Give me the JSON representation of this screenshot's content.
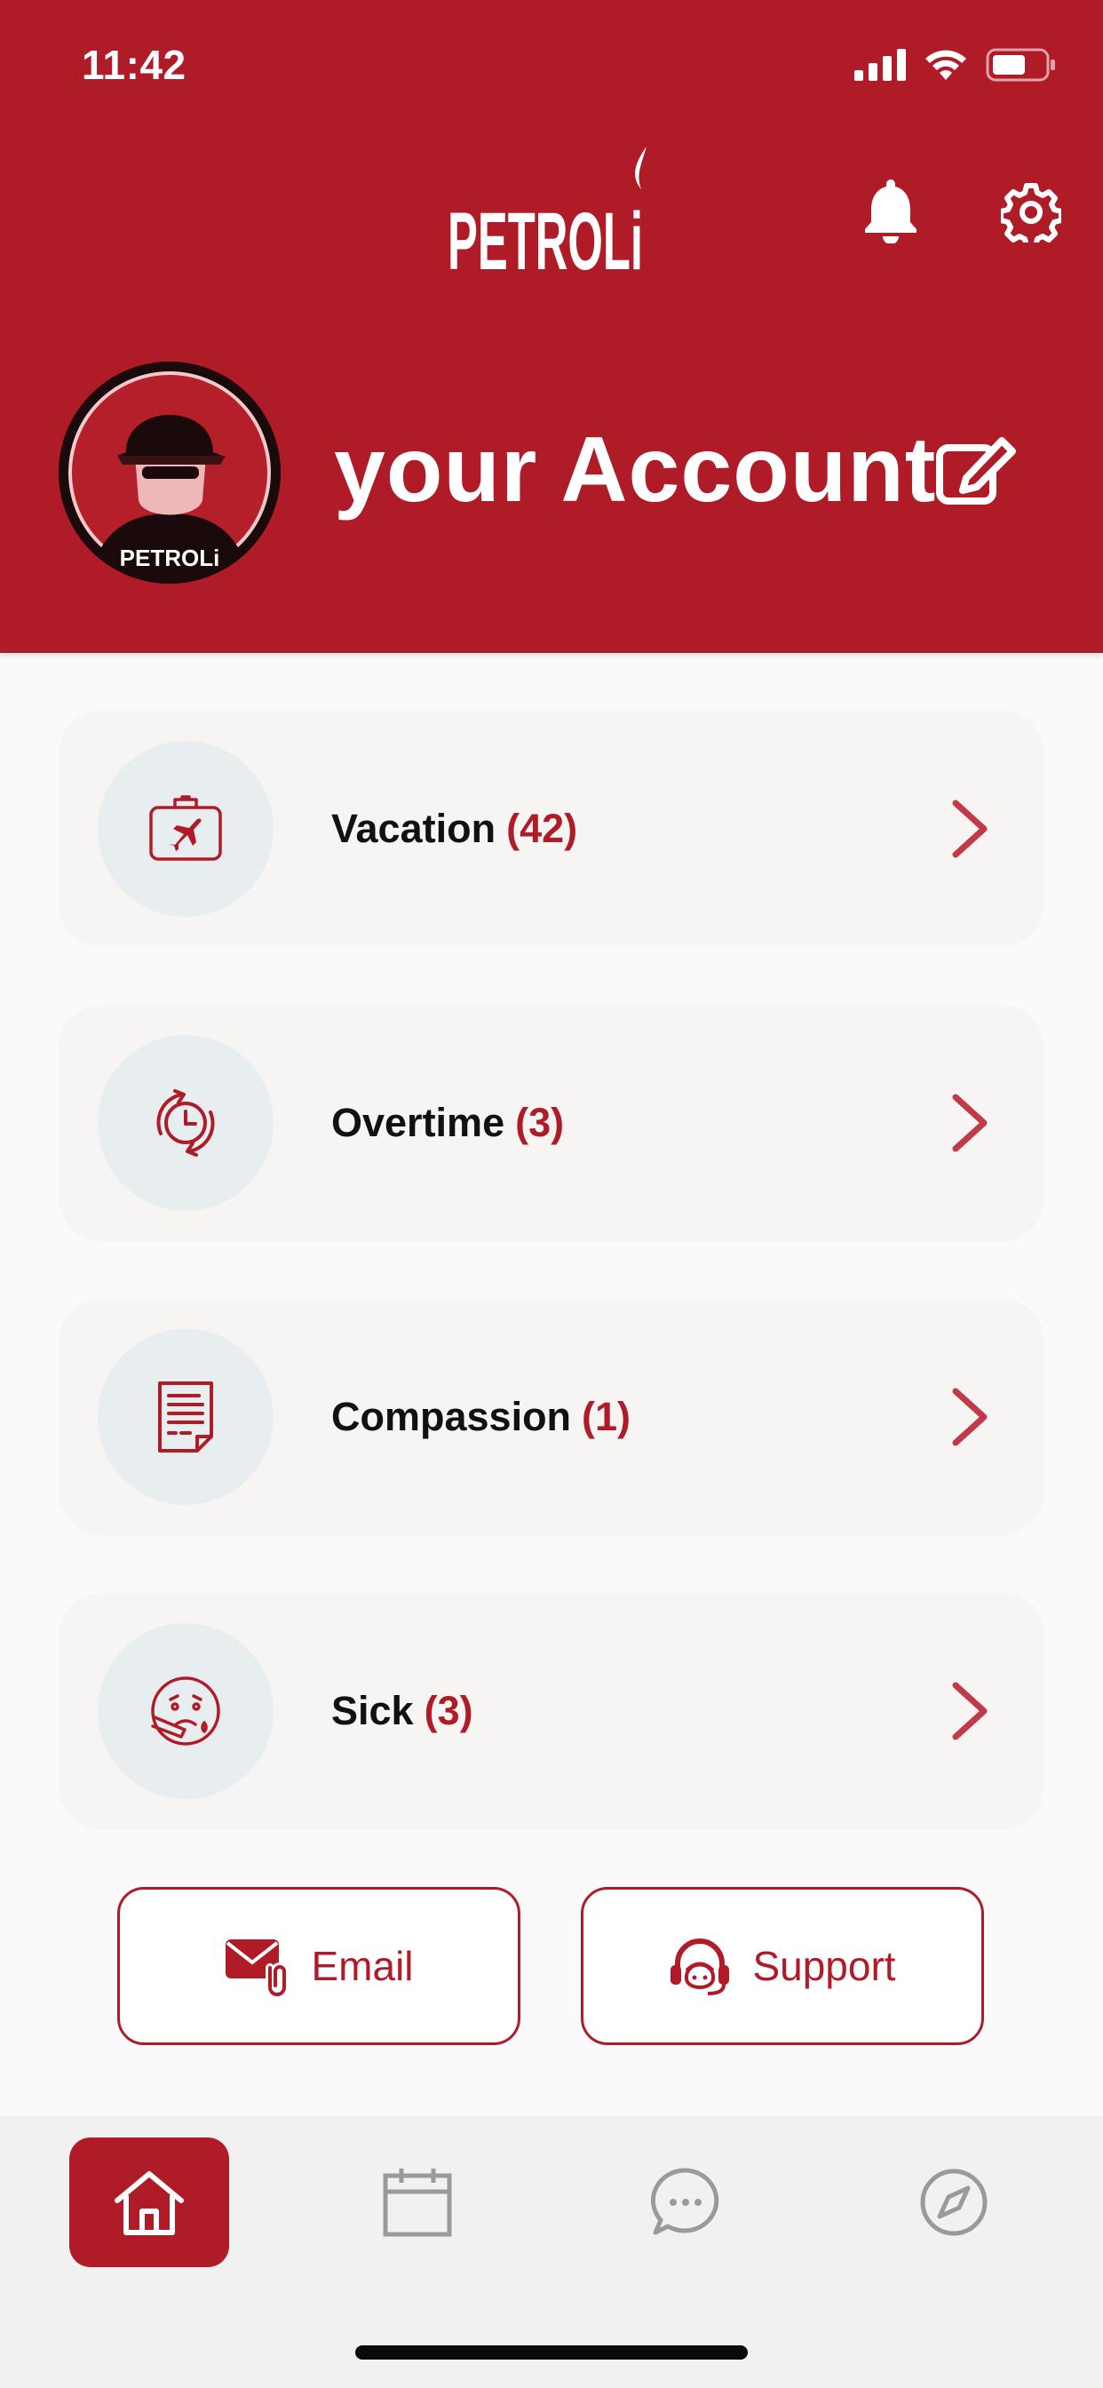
{
  "status_bar": {
    "time": "11:42"
  },
  "header": {
    "brand": "PETROLi",
    "title": "your Account",
    "avatar_caption": "PETROLi"
  },
  "leave_items": [
    {
      "label": "Vacation",
      "count": "(42)",
      "icon": "suitcase-plane-icon"
    },
    {
      "label": "Overtime",
      "count": "(3)",
      "icon": "clock-refresh-icon"
    },
    {
      "label": "Compassion",
      "count": "(1)",
      "icon": "document-icon"
    },
    {
      "label": "Sick",
      "count": "(3)",
      "icon": "sick-face-icon"
    }
  ],
  "actions": {
    "email_label": "Email",
    "support_label": "Support"
  },
  "tabs": [
    {
      "icon": "home-icon",
      "active": true
    },
    {
      "icon": "calendar-icon",
      "active": false
    },
    {
      "icon": "chat-icon",
      "active": false
    },
    {
      "icon": "compass-icon",
      "active": false
    }
  ],
  "colors": {
    "brand": "#b01b28",
    "card_bg": "#f6f5f4",
    "icon_circle": "#e8eeef",
    "tabbar_bg": "#f1f1f1"
  }
}
